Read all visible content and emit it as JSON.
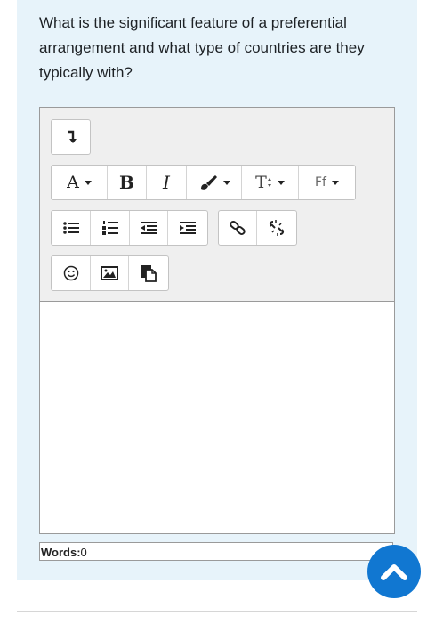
{
  "question": {
    "text": "What is the significant feature of a preferential arrangement and what type of countries are they typically with?"
  },
  "toolbar": {
    "font_color_label": "A",
    "bold_label": "B",
    "italic_label": "I",
    "style_label": "T",
    "font_family_label": "Ff"
  },
  "footer": {
    "words_label": "Words:",
    "words_count": "0"
  },
  "colors": {
    "card_background": "#e7f3fa",
    "accent": "#1177d1",
    "toolbar_background": "#efefef"
  },
  "icons": {
    "toggle": "arrow-down-icon",
    "paintbrush": "paintbrush-icon",
    "unordered_list": "unordered-list-icon",
    "ordered_list": "ordered-list-icon",
    "outdent": "outdent-icon",
    "indent": "indent-icon",
    "link": "link-icon",
    "unlink": "unlink-icon",
    "emoji": "emoji-icon",
    "image": "image-icon",
    "media": "media-icon",
    "scroll_top": "chevron-up-icon"
  }
}
